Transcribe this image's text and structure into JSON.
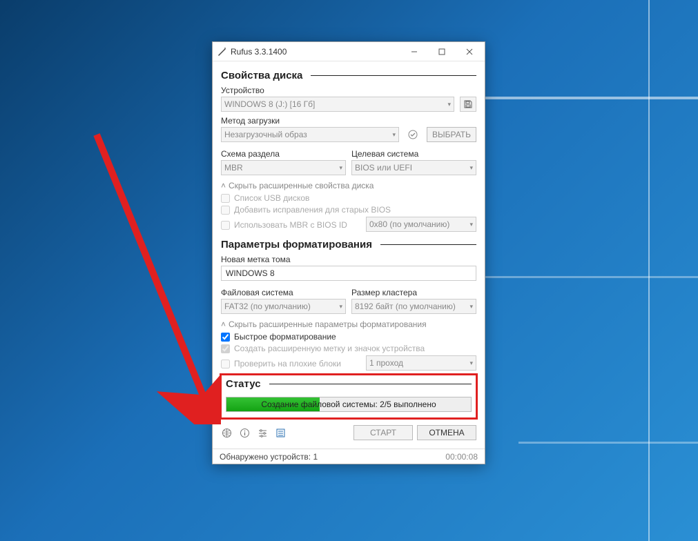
{
  "window": {
    "title": "Rufus 3.3.1400"
  },
  "sections": {
    "disk": {
      "heading": "Свойства диска",
      "device_label": "Устройство",
      "device_value": "WINDOWS 8 (J:) [16 Гб]",
      "boot_method_label": "Метод загрузки",
      "boot_method_value": "Незагрузочный образ",
      "select_btn": "ВЫБРАТЬ",
      "partition_label": "Схема раздела",
      "partition_value": "MBR",
      "target_label": "Целевая система",
      "target_value": "BIOS или UEFI",
      "toggle_adv": "Скрыть расширенные свойства диска",
      "chk_list_usb": "Список USB дисков",
      "chk_bios_fix": "Добавить исправления для старых BIOS",
      "chk_mbr_bios": "Использовать MBR с BIOS ID",
      "bios_id_value": "0x80 (по умолчанию)"
    },
    "format": {
      "heading": "Параметры форматирования",
      "volume_label": "Новая метка тома",
      "volume_value": "WINDOWS 8",
      "fs_label": "Файловая система",
      "fs_value": "FAT32 (по умолчанию)",
      "cluster_label": "Размер кластера",
      "cluster_value": "8192 байт (по умолчанию)",
      "toggle_adv": "Скрыть расширенные параметры форматирования",
      "chk_quick": "Быстрое форматирование",
      "chk_ext_label": "Создать расширенную метку и значок устройства",
      "chk_bad_blocks": "Проверить на плохие блоки",
      "passes_value": "1 проход"
    },
    "status": {
      "heading": "Статус",
      "progress_text": "Создание файловой системы: 2/5 выполнено",
      "progress_pct": 38
    }
  },
  "buttons": {
    "start": "СТАРТ",
    "cancel": "ОТМЕНА"
  },
  "statusbar": {
    "devices": "Обнаружено устройств: 1",
    "timer": "00:00:08"
  }
}
